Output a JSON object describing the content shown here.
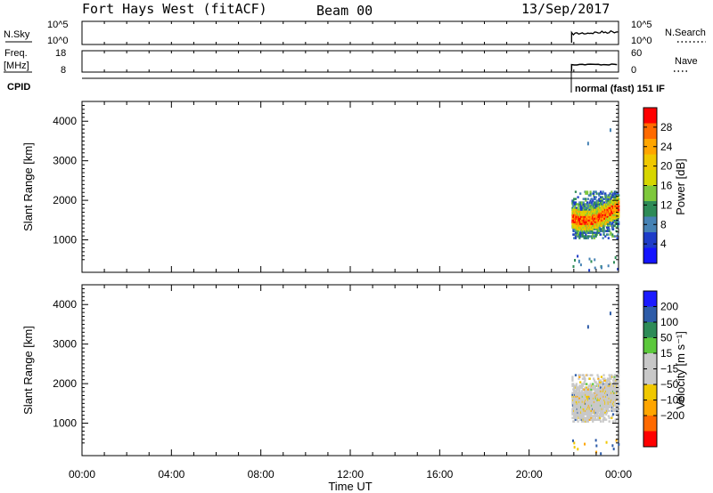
{
  "header": {
    "station": "Fort Hays West (fitACF)",
    "beam": "Beam 00",
    "date": "13/Sep/2017"
  },
  "params": {
    "nsky_label": "N.Sky",
    "nsearch_label": "N.Search",
    "nsky_ticks": [
      "10^5",
      "10^0"
    ],
    "nsearch_ticks": [
      "10^5",
      "10^0"
    ],
    "freq_label": "Freq.",
    "freq_unit": "[MHz]",
    "freq_ticks": [
      "18",
      "8"
    ],
    "nave_label": "Nave",
    "nave_ticks": [
      "60",
      "0"
    ],
    "cpid_label": "CPID",
    "cpid_value": "normal (fast) 151 IF"
  },
  "x_axis": {
    "label": "Time UT",
    "ticks": [
      "00:00",
      "04:00",
      "08:00",
      "12:00",
      "16:00",
      "20:00",
      "00:00"
    ]
  },
  "chart_data": [
    {
      "type": "heatmap",
      "title": "",
      "ylabel": "Slant Range [km]",
      "xlabel": "Time UT",
      "x_range_hours": [
        0,
        24
      ],
      "ylim": [
        180,
        4500
      ],
      "y_ticks": [
        1000,
        2000,
        3000,
        4000
      ],
      "colorbar": {
        "label": "Power [dB]",
        "ticks": [
          "28",
          "24",
          "20",
          "16",
          "12",
          "8",
          "4"
        ],
        "range": [
          0,
          32
        ],
        "colors": [
          "#ff0000",
          "#ff6a00",
          "#ffa500",
          "#f0c800",
          "#d6d600",
          "#7ec83c",
          "#2e8b57",
          "#4682b4",
          "#1e3cc8",
          "#1414ff"
        ]
      },
      "scatter_region": {
        "time_hours": [
          21.9,
          24.0
        ],
        "main_band_range_km": [
          1150,
          2200
        ],
        "strongest_range_km": [
          1350,
          1650
        ],
        "sparse_points": [
          {
            "time": 22.6,
            "range": 3480
          },
          {
            "time": 23.6,
            "range": 3820
          },
          {
            "time": 22.2,
            "range": 500
          },
          {
            "time": 23.2,
            "range": 350
          }
        ]
      }
    },
    {
      "type": "heatmap",
      "title": "",
      "ylabel": "Slant Range [km]",
      "xlabel": "Time UT",
      "x_range_hours": [
        0,
        24
      ],
      "ylim": [
        180,
        4500
      ],
      "y_ticks": [
        1000,
        2000,
        3000,
        4000
      ],
      "colorbar": {
        "label": "Velocity [m s⁻¹]",
        "ticks": [
          "200",
          "100",
          "50",
          "15",
          "−15",
          "−50",
          "−100",
          "−200"
        ],
        "colors": [
          "#1a1aff",
          "#2e5ca8",
          "#2e8b57",
          "#5cc83c",
          "#c8c8c8",
          "#c8c8c8",
          "#f0c800",
          "#ffa500",
          "#ff6a00",
          "#ff0000"
        ]
      },
      "scatter_region": {
        "time_hours": [
          21.9,
          24.0
        ],
        "main_band_range_km": [
          1200,
          2200
        ],
        "dominant": "ground scatter (grey)",
        "sparse_points": [
          {
            "time": 22.6,
            "range": 3480
          },
          {
            "time": 23.6,
            "range": 3820
          }
        ]
      }
    }
  ]
}
